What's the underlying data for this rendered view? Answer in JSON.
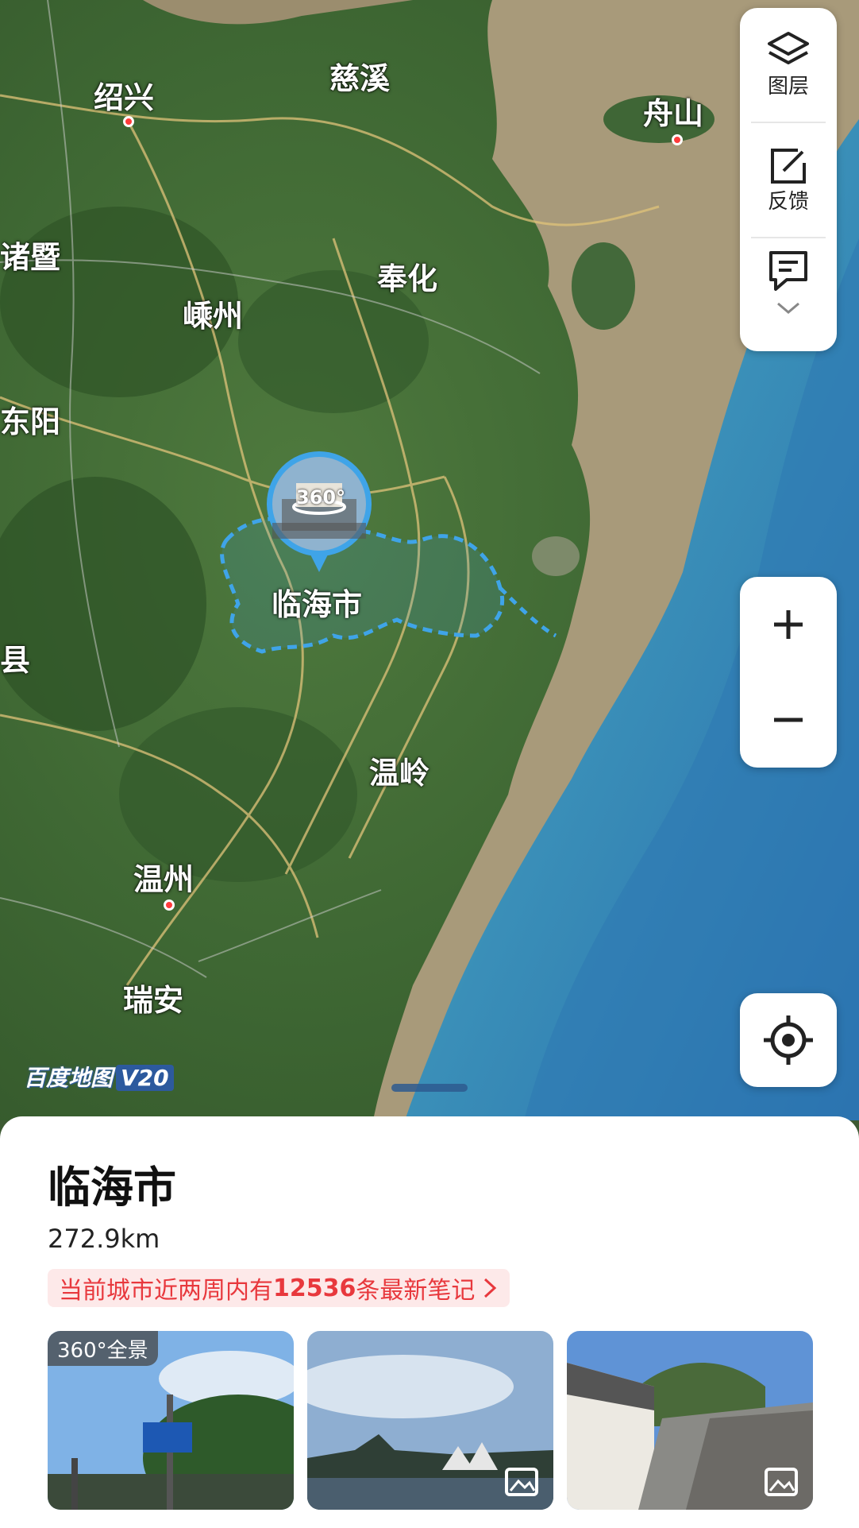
{
  "map": {
    "cities": [
      {
        "name": "绍兴",
        "dot": true
      },
      {
        "name": "慈溪",
        "dot": false
      },
      {
        "name": "舟山",
        "dot": true
      },
      {
        "name": "诸暨",
        "dot": false
      },
      {
        "name": "奉化",
        "dot": false
      },
      {
        "name": "嵊州",
        "dot": false
      },
      {
        "name": "东阳",
        "dot": false
      },
      {
        "name": "县",
        "dot": false
      },
      {
        "name": "温岭",
        "dot": false
      },
      {
        "name": "温州",
        "dot": true
      },
      {
        "name": "瑞安",
        "dot": false
      }
    ],
    "marker": {
      "label": "临海市",
      "badge": "360°"
    },
    "watermark": {
      "brand": "百度地图",
      "version": "V20"
    },
    "colors": {
      "boundary": "#3fa4e8",
      "accent": "#2d5a9e"
    }
  },
  "toolbar": {
    "layers_label": "图层",
    "feedback_label": "反馈",
    "more_icon": "chevron-down-icon"
  },
  "zoom": {
    "in_icon": "plus-icon",
    "out_icon": "minus-icon"
  },
  "locate": {
    "icon": "locate-target-icon"
  },
  "sheet": {
    "title": "临海市",
    "distance": "272.9km",
    "notes": {
      "prefix": "当前城市近两周内有",
      "count": "12536",
      "suffix": "条最新笔记"
    },
    "photos": [
      {
        "badge": "360°全景"
      },
      {
        "icon": "image-icon"
      },
      {
        "icon": "image-icon"
      }
    ]
  }
}
